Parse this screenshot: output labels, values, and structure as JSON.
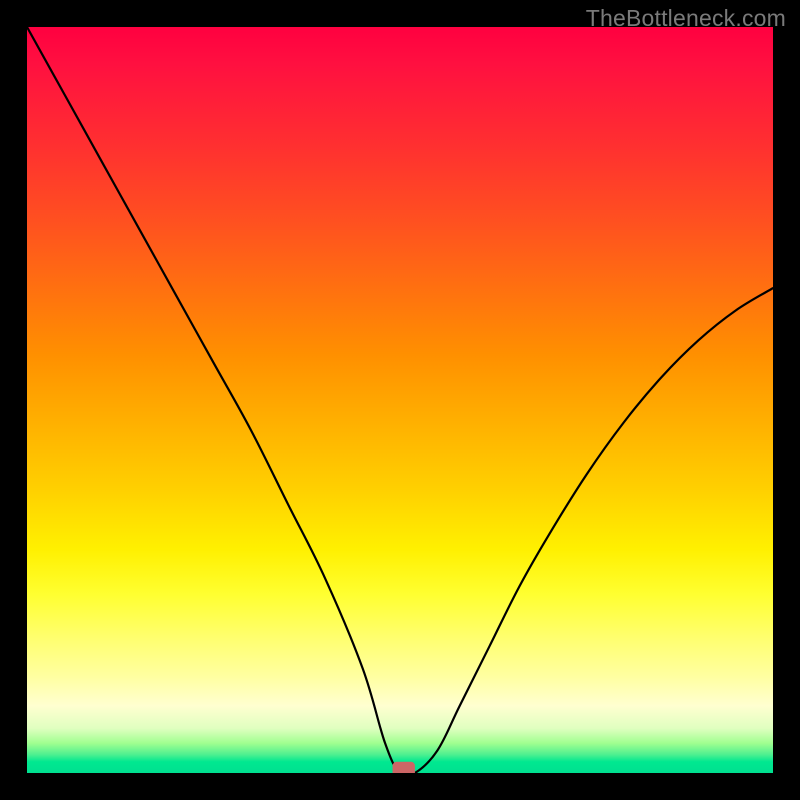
{
  "watermark": {
    "text": "TheBottleneck.com"
  },
  "chart_data": {
    "type": "line",
    "title": "",
    "xlabel": "",
    "ylabel": "",
    "xlim": [
      0,
      100
    ],
    "ylim": [
      0,
      100
    ],
    "series": [
      {
        "name": "bottleneck-curve",
        "x": [
          0,
          5,
          10,
          15,
          20,
          25,
          30,
          35,
          40,
          45,
          48,
          50,
          52,
          55,
          58,
          62,
          66,
          70,
          75,
          80,
          85,
          90,
          95,
          100
        ],
        "values": [
          100,
          91,
          82,
          73,
          64,
          55,
          46,
          36,
          26,
          14,
          4,
          0,
          0,
          3,
          9,
          17,
          25,
          32,
          40,
          47,
          53,
          58,
          62,
          65
        ]
      }
    ],
    "marker": {
      "x": 50.5,
      "y": 0.5,
      "w": 3,
      "h": 2,
      "name": "optimal-point"
    },
    "gradient_stops": [
      {
        "pct": 0,
        "color": "#ff0040"
      },
      {
        "pct": 50,
        "color": "#ffc000"
      },
      {
        "pct": 90,
        "color": "#ffffc0"
      },
      {
        "pct": 100,
        "color": "#00e090"
      }
    ]
  }
}
